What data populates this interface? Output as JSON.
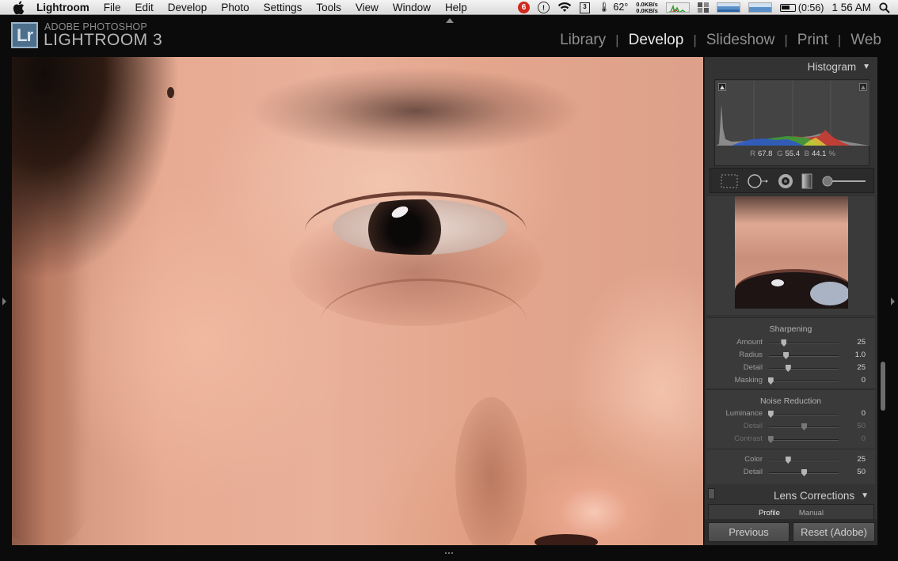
{
  "menubar": {
    "app_name": "Lightroom",
    "items": [
      "File",
      "Edit",
      "Develop",
      "Photo",
      "Settings",
      "Tools",
      "View",
      "Window",
      "Help"
    ],
    "temperature": "62°",
    "net_up": "0.0KB/s",
    "net_down": "0.0KB/s",
    "battery_time": "(0:56)",
    "clock": "1 56 AM",
    "calendar_day": "3"
  },
  "app": {
    "brand_small": "ADOBE PHOTOSHOP",
    "brand_big": "LIGHTROOM 3",
    "logo": "Lr",
    "modules": [
      "Library",
      "Develop",
      "Slideshow",
      "Print",
      "Web"
    ],
    "active_module": "Develop"
  },
  "panel": {
    "histogram_title": "Histogram",
    "rgb": {
      "r_label": "R",
      "r": "67.8",
      "g_label": "G",
      "g": "55.4",
      "b_label": "B",
      "b": "44.1",
      "unit": "%"
    },
    "sharpening": {
      "title": "Sharpening",
      "rows": [
        {
          "label": "Amount",
          "value": "25",
          "pos": 0.21
        },
        {
          "label": "Radius",
          "value": "1.0",
          "pos": 0.24
        },
        {
          "label": "Detail",
          "value": "25",
          "pos": 0.27
        },
        {
          "label": "Masking",
          "value": "0",
          "pos": 0.02
        }
      ]
    },
    "noise": {
      "title": "Noise Reduction",
      "rows": [
        {
          "label": "Luminance",
          "value": "0",
          "pos": 0.02,
          "dim": false
        },
        {
          "label": "Detail",
          "value": "50",
          "pos": 0.5,
          "dim": true
        },
        {
          "label": "Contrast",
          "value": "0",
          "pos": 0.02,
          "dim": true
        }
      ],
      "color_rows": [
        {
          "label": "Color",
          "value": "25",
          "pos": 0.27
        },
        {
          "label": "Detail",
          "value": "50",
          "pos": 0.5
        }
      ]
    },
    "lens_title": "Lens Corrections",
    "lens_tabs": [
      "Profile",
      "Manual"
    ],
    "previous_label": "Previous",
    "reset_label": "Reset (Adobe)"
  }
}
